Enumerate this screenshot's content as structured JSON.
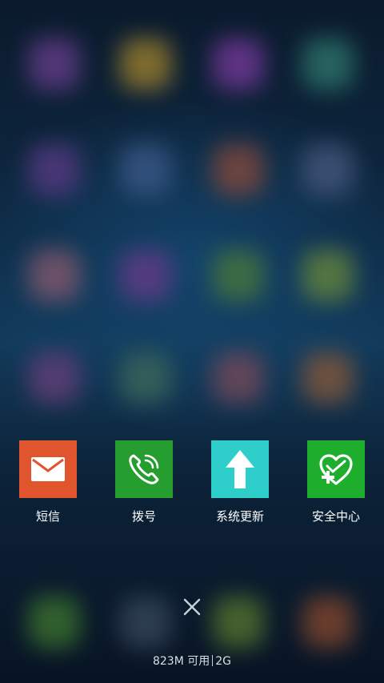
{
  "apps": [
    {
      "label": "短信",
      "icon": "envelope-icon",
      "color": "#e0552d"
    },
    {
      "label": "拨号",
      "icon": "phone-call-icon",
      "color": "#259d2f"
    },
    {
      "label": "系统更新",
      "icon": "up-arrow-icon",
      "color": "#2ecfcb"
    },
    {
      "label": "安全中心",
      "icon": "heart-shield-plus-icon",
      "color": "#1fad2e"
    }
  ],
  "close_icon": "close-icon",
  "status": {
    "memory": "823M 可用",
    "network": "2G"
  }
}
